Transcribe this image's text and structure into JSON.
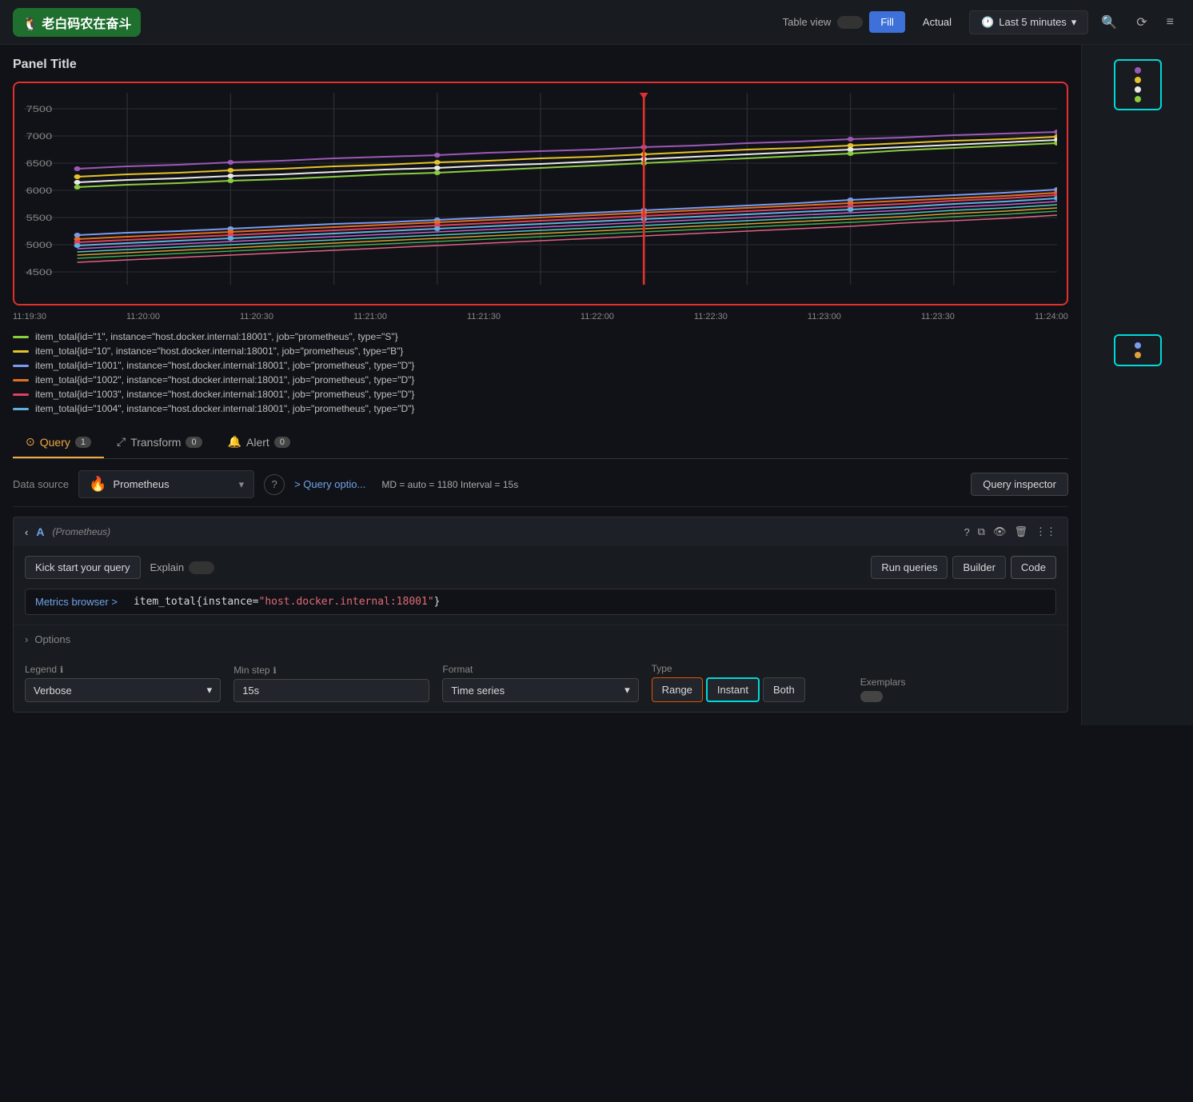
{
  "app": {
    "logo_text": "🐧 老白码农在奋斗",
    "table_view_label": "Table view",
    "fill_label": "Fill",
    "actual_label": "Actual",
    "time_range_label": "Last 5 minutes",
    "panel_title": "Panel Title"
  },
  "tabs": {
    "query_label": "Query",
    "query_badge": "1",
    "transform_label": "Transform",
    "transform_badge": "0",
    "alert_label": "Alert",
    "alert_badge": "0"
  },
  "datasource": {
    "label": "Data source",
    "name": "Prometheus",
    "query_options_label": "> Query optio...",
    "interval_info": "MD = auto = 1180   Interval = 15s",
    "query_inspector_label": "Query inspector"
  },
  "query_block": {
    "letter": "A",
    "source_tag": "(Prometheus)",
    "kick_start_label": "Kick start your query",
    "explain_label": "Explain",
    "run_queries_label": "Run queries",
    "builder_label": "Builder",
    "code_label": "Code",
    "metrics_browser_label": "Metrics browser >",
    "query_value": "item_total{instance=\"host.docker.internal:18001\"}"
  },
  "options": {
    "header": "Options",
    "legend_label": "Legend",
    "legend_value": "Verbose",
    "min_step_label": "Min step",
    "min_step_value": "15s",
    "format_label": "Format",
    "format_value": "Time series",
    "type_label": "Type",
    "range_label": "Range",
    "instant_label": "Instant",
    "both_label": "Both",
    "exemplars_label": "Exemplars"
  },
  "time_axis": {
    "labels": [
      "11:19:30",
      "11:20:00",
      "11:20:30",
      "11:21:00",
      "11:21:30",
      "11:22:00",
      "11:22:30",
      "11:23:00",
      "11:23:30",
      "11:24:00"
    ]
  },
  "y_axis": {
    "values": [
      "7500",
      "7000",
      "6500",
      "6000",
      "5500",
      "5000",
      "4500"
    ]
  },
  "legend_items": [
    {
      "color": "#8acd3f",
      "text": "item_total{id=\"1\", instance=\"host.docker.internal:18001\", job=\"prometheus\", type=\"S\"}"
    },
    {
      "color": "#e5c229",
      "text": "item_total{id=\"10\", instance=\"host.docker.internal:18001\", job=\"prometheus\", type=\"B\"}"
    },
    {
      "color": "#7a9bf1",
      "text": "item_total{id=\"1001\", instance=\"host.docker.internal:18001\", job=\"prometheus\", type=\"D\"}"
    },
    {
      "color": "#e07020",
      "text": "item_total{id=\"1002\", instance=\"host.docker.internal:18001\", job=\"prometheus\", type=\"D\"}"
    },
    {
      "color": "#e04060",
      "text": "item_total{id=\"1003\", instance=\"host.docker.internal:18001\", job=\"prometheus\", type=\"D\"}"
    },
    {
      "color": "#60b0e0",
      "text": "item_total{id=\"1004\", instance=\"host.docker.internal:18001\", job=\"prometheus\", type=\"D\"}"
    }
  ],
  "icons": {
    "clock": "🕐",
    "search": "🔍",
    "refresh": "⟳",
    "chevron_down": "▾",
    "chevron_right": "›",
    "dots": "⋮",
    "copy": "⧉",
    "eye": "👁",
    "trash": "🗑",
    "help": "?",
    "collapse": "‹",
    "expand": "›",
    "fire": "🔥"
  }
}
